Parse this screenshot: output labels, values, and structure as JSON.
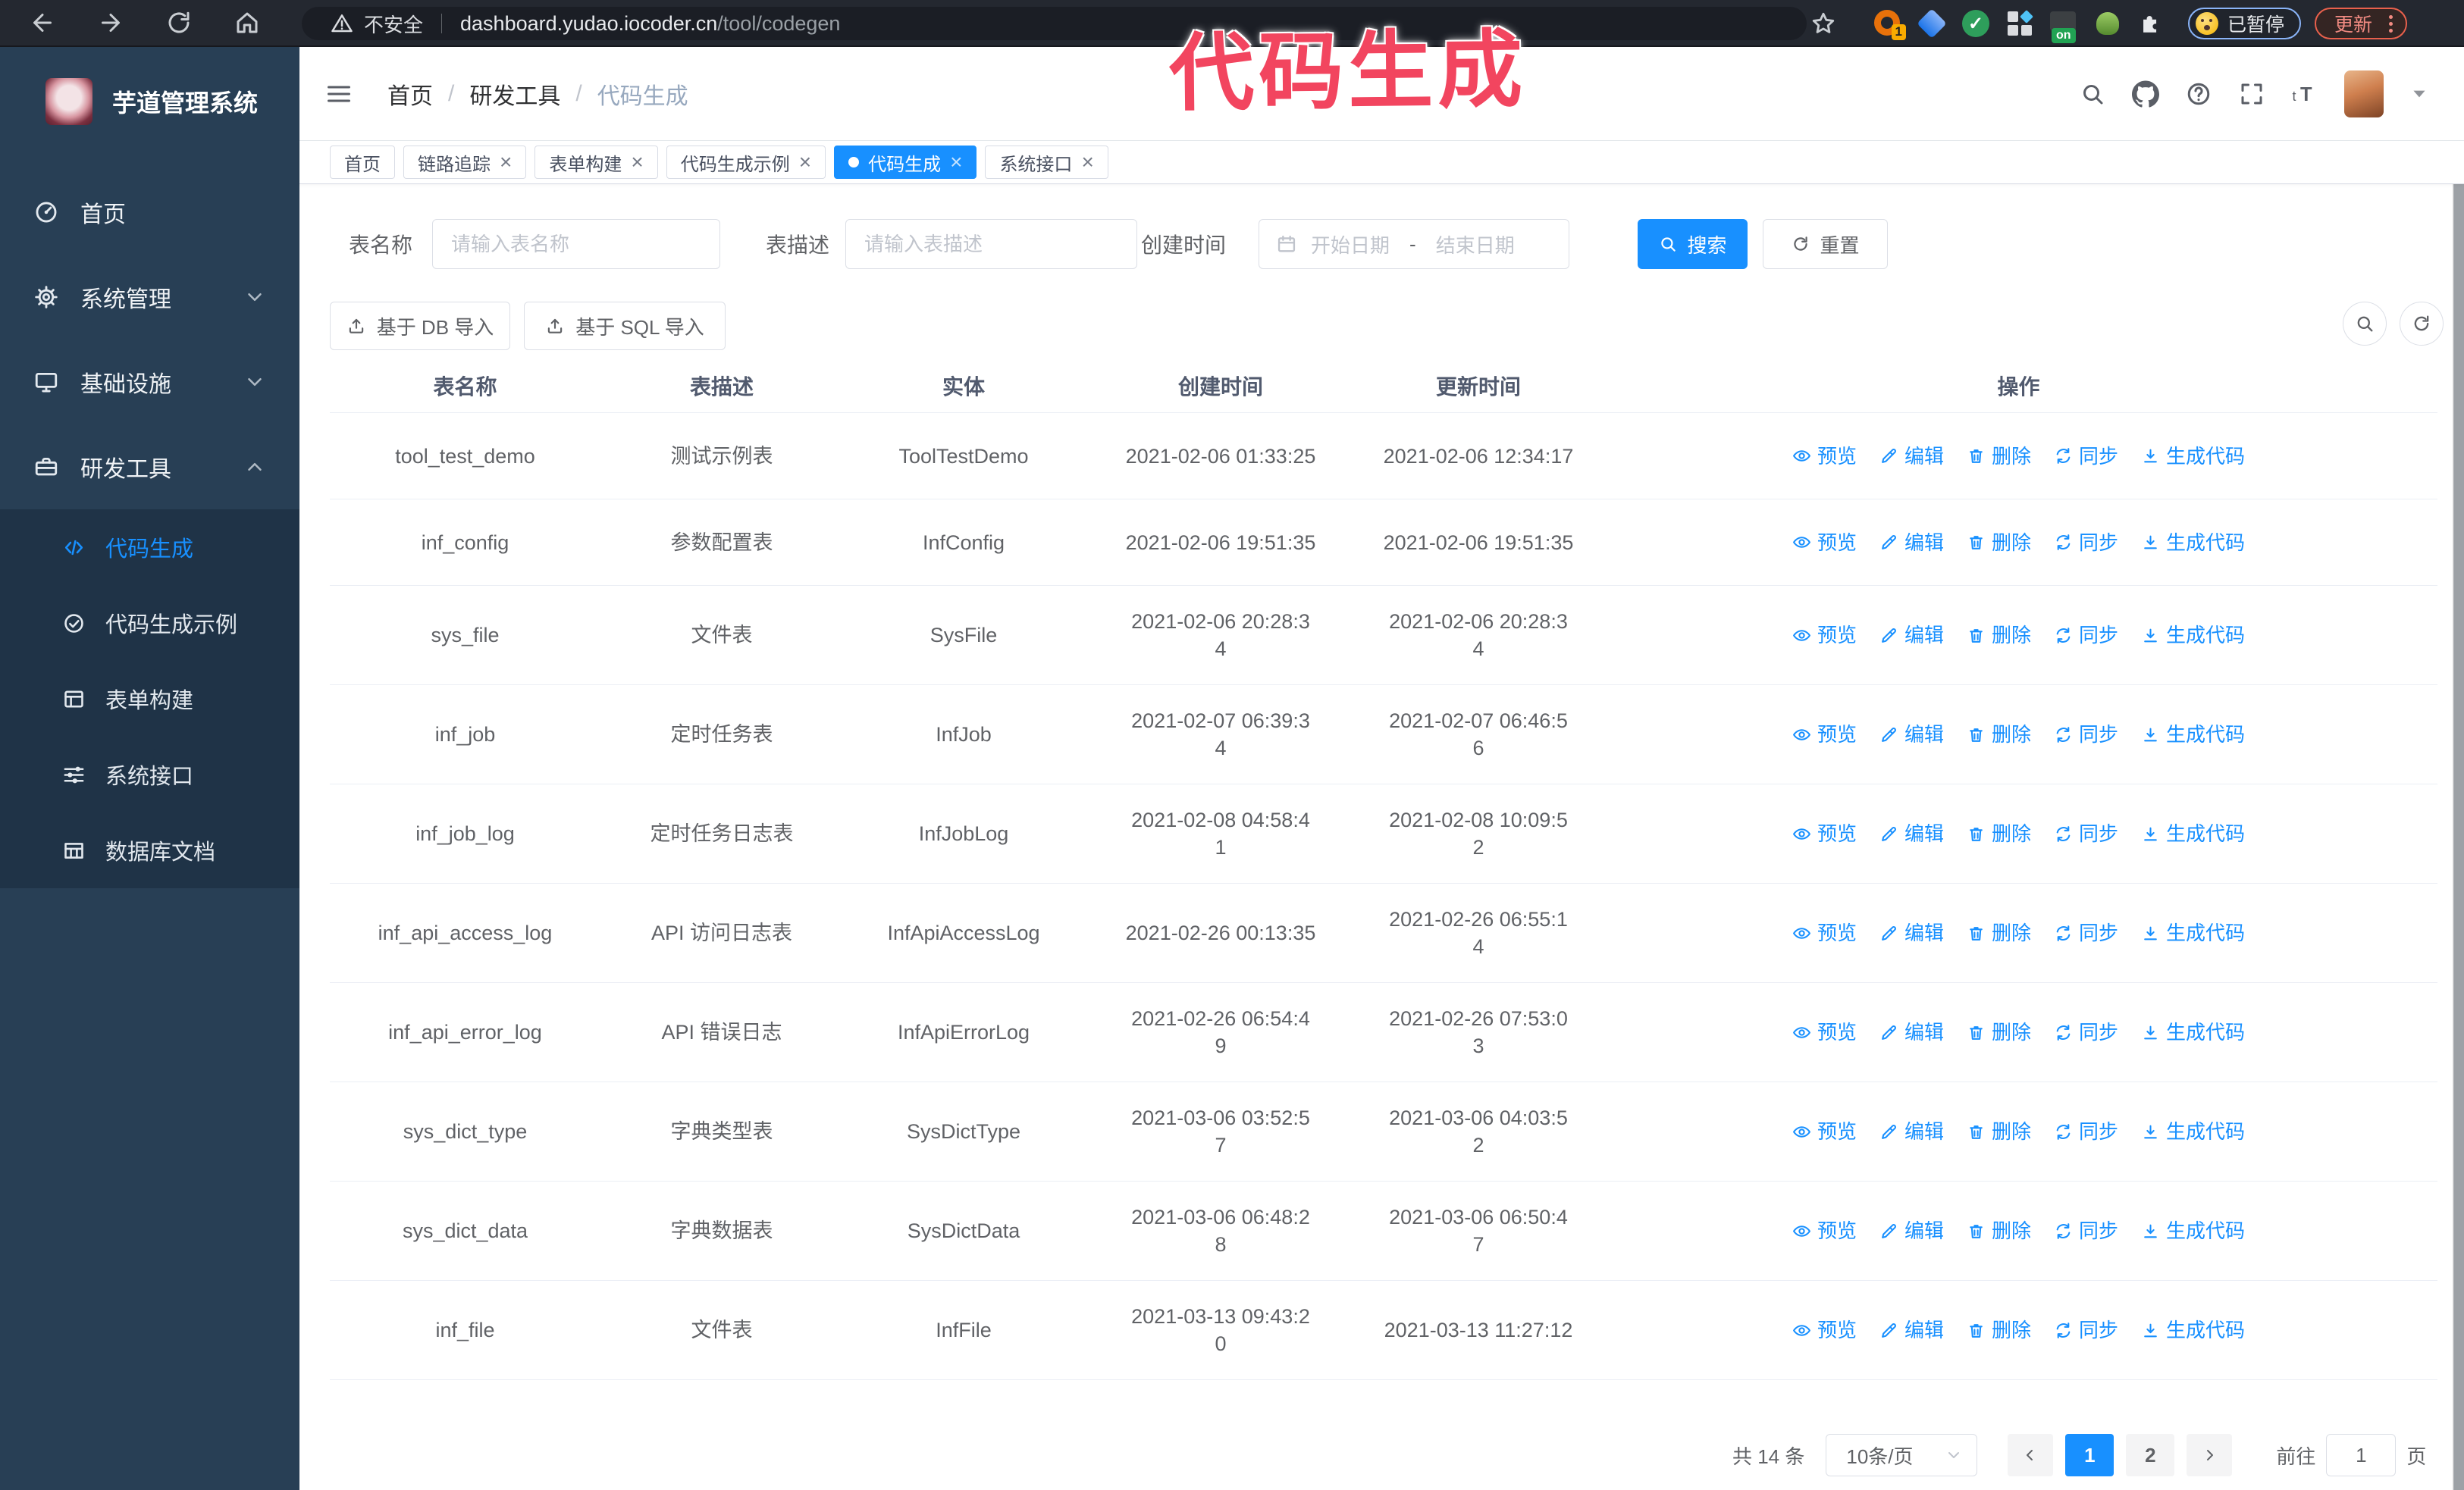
{
  "browser": {
    "security_label": "不安全",
    "url_domain": "dashboard.yudao.iocoder.cn",
    "url_path": "/tool/codegen",
    "ext_badge": "1",
    "ext_check": "✓",
    "ext_on_label": "on",
    "paused_label": "已暂停",
    "update_label": "更新"
  },
  "annotation": {
    "text": "代码生成"
  },
  "sidebar": {
    "title": "芋道管理系统",
    "items": [
      {
        "label": "首页"
      },
      {
        "label": "系统管理"
      },
      {
        "label": "基础设施"
      },
      {
        "label": "研发工具"
      }
    ],
    "sub_items": [
      {
        "label": "代码生成"
      },
      {
        "label": "代码生成示例"
      },
      {
        "label": "表单构建"
      },
      {
        "label": "系统接口"
      },
      {
        "label": "数据库文档"
      }
    ]
  },
  "breadcrumb": {
    "separator": "/",
    "items": [
      "首页",
      "研发工具",
      "代码生成"
    ]
  },
  "tabs": {
    "close_glyph": "×",
    "items": [
      {
        "label": "首页"
      },
      {
        "label": "链路追踪"
      },
      {
        "label": "表单构建"
      },
      {
        "label": "代码生成示例"
      },
      {
        "label": "代码生成"
      },
      {
        "label": "系统接口"
      }
    ]
  },
  "filters": {
    "name_label": "表名称",
    "name_placeholder": "请输入表名称",
    "desc_label": "表描述",
    "desc_placeholder": "请输入表描述",
    "time_label": "创建时间",
    "start_placeholder": "开始日期",
    "range_separator": "-",
    "end_placeholder": "结束日期",
    "search_label": "搜索",
    "reset_label": "重置"
  },
  "toolbar": {
    "db_import_label": "基于 DB 导入",
    "sql_import_label": "基于 SQL 导入"
  },
  "table": {
    "headers": [
      "表名称",
      "表描述",
      "实体",
      "创建时间",
      "更新时间",
      "操作"
    ],
    "rows": [
      {
        "name": "tool_test_demo",
        "desc": "测试示例表",
        "entity": "ToolTestDemo",
        "created": "2021-02-06 01:33:25",
        "updated": "2021-02-06 12:34:17"
      },
      {
        "name": "inf_config",
        "desc": "参数配置表",
        "entity": "InfConfig",
        "created": "2021-02-06 19:51:35",
        "updated": "2021-02-06 19:51:35"
      },
      {
        "name": "sys_file",
        "desc": "文件表",
        "entity": "SysFile",
        "created": "2021-02-06 20:28:3\n4",
        "updated": "2021-02-06 20:28:3\n4"
      },
      {
        "name": "inf_job",
        "desc": "定时任务表",
        "entity": "InfJob",
        "created": "2021-02-07 06:39:3\n4",
        "updated": "2021-02-07 06:46:5\n6"
      },
      {
        "name": "inf_job_log",
        "desc": "定时任务日志表",
        "entity": "InfJobLog",
        "created": "2021-02-08 04:58:4\n1",
        "updated": "2021-02-08 10:09:5\n2"
      },
      {
        "name": "inf_api_access_log",
        "desc": "API 访问日志表",
        "entity": "InfApiAccessLog",
        "created": "2021-02-26 00:13:35",
        "updated": "2021-02-26 06:55:1\n4"
      },
      {
        "name": "inf_api_error_log",
        "desc": "API 错误日志",
        "entity": "InfApiErrorLog",
        "created": "2021-02-26 06:54:4\n9",
        "updated": "2021-02-26 07:53:0\n3"
      },
      {
        "name": "sys_dict_type",
        "desc": "字典类型表",
        "entity": "SysDictType",
        "created": "2021-03-06 03:52:5\n7",
        "updated": "2021-03-06 04:03:5\n2"
      },
      {
        "name": "sys_dict_data",
        "desc": "字典数据表",
        "entity": "SysDictData",
        "created": "2021-03-06 06:48:2\n8",
        "updated": "2021-03-06 06:50:4\n7"
      },
      {
        "name": "inf_file",
        "desc": "文件表",
        "entity": "InfFile",
        "created": "2021-03-13 09:43:2\n0",
        "updated": "2021-03-13 11:27:12"
      }
    ]
  },
  "actions": {
    "preview": "预览",
    "edit": "编辑",
    "delete": "删除",
    "sync": "同步",
    "generate": "生成代码"
  },
  "pagination": {
    "total": "共 14 条",
    "page_size": "10条/页",
    "page_1": "1",
    "page_2": "2",
    "goto_label": "前往",
    "goto_value": "1",
    "unit_label": "页"
  },
  "colors": {
    "accent": "#1890ff",
    "sidebar": "#283F55",
    "annotation": "#f2455f"
  }
}
